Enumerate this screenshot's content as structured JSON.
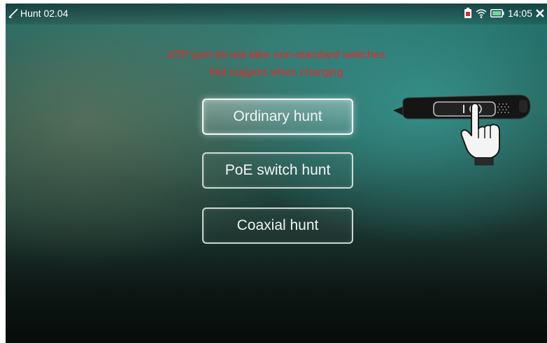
{
  "status_bar": {
    "title": "Hunt 02.04",
    "time": "14:05",
    "icons": [
      "pen-icon",
      "battery-alert-icon",
      "wifi-icon",
      "charging-icon",
      "close-icon"
    ]
  },
  "warnings": {
    "line1": "UTP port do not take non-standard switches",
    "line2": "Not support when charging"
  },
  "menu": {
    "items": [
      {
        "label": "Ordinary hunt",
        "selected": true
      },
      {
        "label": "PoE switch hunt",
        "selected": false
      },
      {
        "label": "Coaxial hunt",
        "selected": false
      }
    ]
  },
  "illustration": {
    "icons": [
      "tone-probe-icon",
      "pressing-hand-icon"
    ]
  },
  "colors": {
    "warning_text": "#e8262a",
    "button_border": "#ebf0eb",
    "status_text": "#ffffff"
  }
}
